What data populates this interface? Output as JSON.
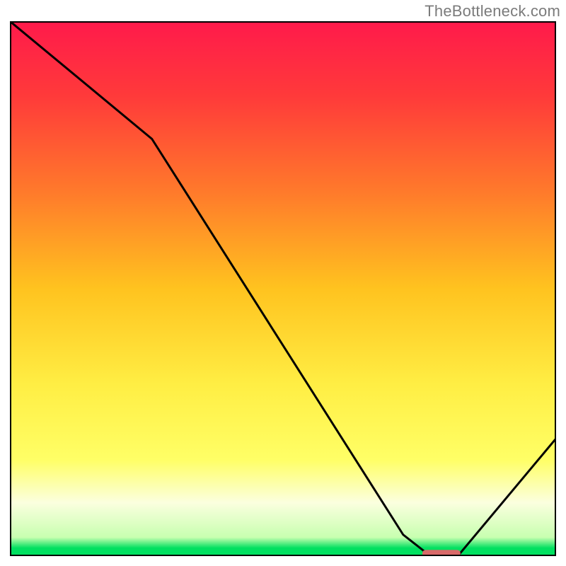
{
  "attribution": "TheBottleneck.com",
  "chart_data": {
    "type": "line",
    "title": "",
    "xlabel": "",
    "ylabel": "",
    "xlim": [
      0,
      100
    ],
    "ylim": [
      0,
      100
    ],
    "background": {
      "top_color": "#ff1a4b",
      "mid_warm": "#ffc31f",
      "mid_yellow": "#ffff66",
      "pale_band": "#fbffdf",
      "bottom_color": "#00e060"
    },
    "series": [
      {
        "name": "curve",
        "x": [
          0,
          26,
          72,
          77,
          82,
          100
        ],
        "y": [
          100,
          78,
          4,
          0,
          0,
          22
        ]
      }
    ],
    "marker": {
      "name": "optimum-marker",
      "x_center": 79,
      "y": 0.5,
      "width": 7,
      "color": "#d86a6a"
    }
  }
}
